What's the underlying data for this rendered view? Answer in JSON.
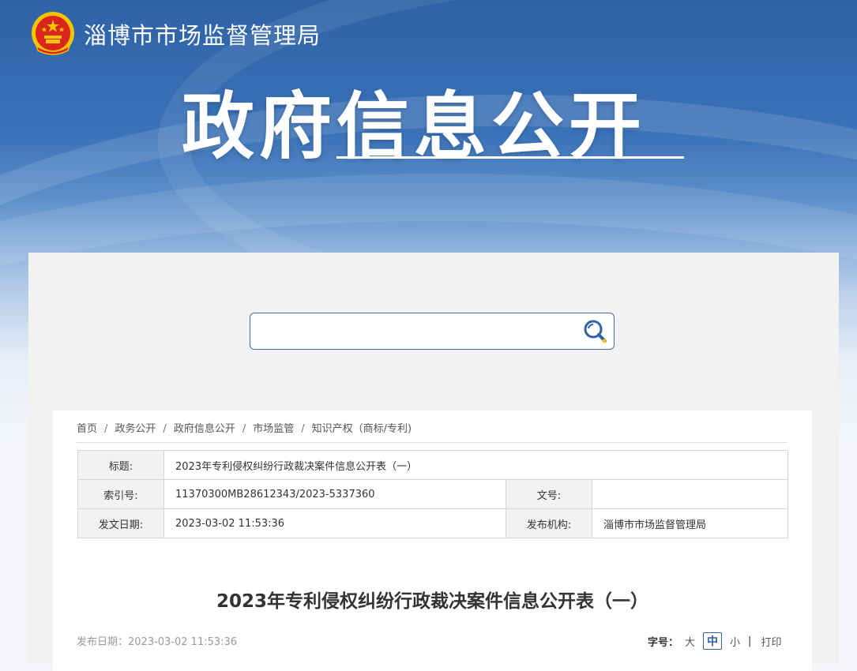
{
  "header": {
    "site_name": "淄博市市场监督管理局",
    "banner_title": "政府信息公开"
  },
  "search": {
    "placeholder": ""
  },
  "breadcrumb": [
    "首页",
    "政务公开",
    "政府信息公开",
    "市场监管",
    "知识产权（商标/专利)"
  ],
  "info": {
    "title_label": "标题:",
    "title_value": "2023年专利侵权纠纷行政裁决案件信息公开表（一）",
    "index_label": "索引号:",
    "index_value": "11370300MB28612343/2023-5337360",
    "docno_label": "文号:",
    "docno_value": "",
    "date_label": "发文日期:",
    "date_value": "2023-03-02 11:53:36",
    "org_label": "发布机构:",
    "org_value": "淄博市市场监督管理局"
  },
  "article": {
    "title": "2023年专利侵权纠纷行政裁决案件信息公开表（一）",
    "pub_date": "发布日期：2023-03-02 11:53:36"
  },
  "font_size": {
    "label": "字号：",
    "large": "大",
    "medium": "中",
    "small": "小",
    "divider": "|",
    "print": "打印"
  },
  "colors": {
    "accent": "#2f62a6",
    "emblem_red": "#d9251c",
    "emblem_gold": "#f5c400"
  }
}
